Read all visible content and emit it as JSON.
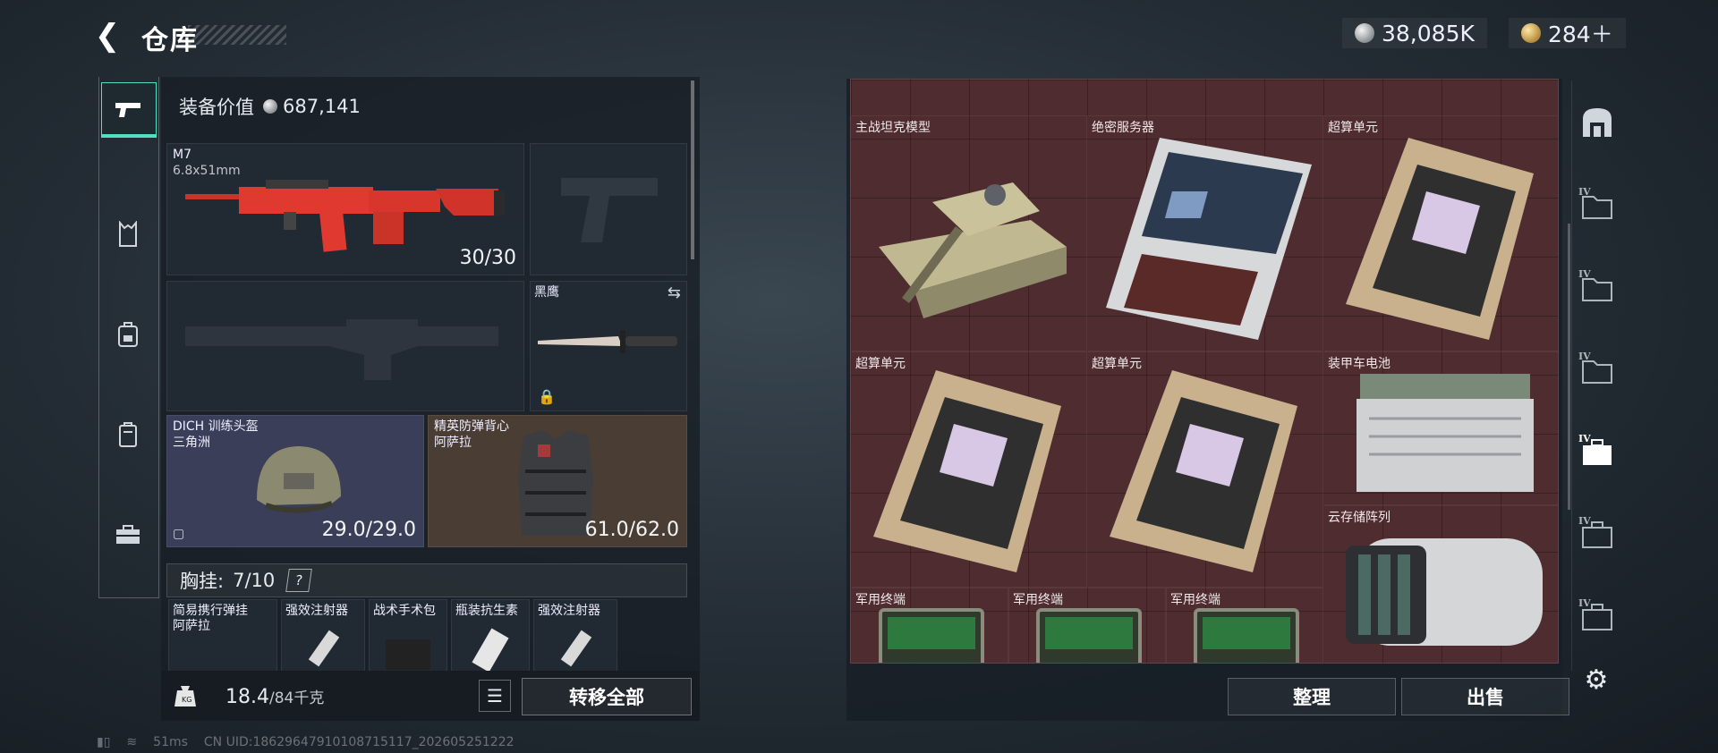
{
  "header": {
    "back_icon": "chevron-left-icon",
    "title": "仓库"
  },
  "currency": {
    "silver": "38,085K",
    "gold": "284＋"
  },
  "left_nav": [
    {
      "icon": "pistol-icon",
      "active": true
    },
    {
      "icon": "vest-icon",
      "active": false
    },
    {
      "icon": "backpack-icon",
      "active": false
    },
    {
      "icon": "pouch-icon",
      "active": false
    },
    {
      "icon": "toolbox-icon",
      "active": false
    }
  ],
  "loadout": {
    "equip_value_label": "装备价值",
    "equip_value": "687,141",
    "primary": {
      "name": "M7",
      "ammo": "6.8x51mm",
      "count": "30/30"
    },
    "knife": {
      "name": "黑鹰"
    },
    "helmet": {
      "name": "DICH 训练头盔",
      "origin": "三角洲",
      "durability": "29.0/29.0"
    },
    "armor": {
      "name": "精英防弹背心",
      "origin": "阿萨拉",
      "durability": "61.0/62.0"
    },
    "chest_label": "胸挂:",
    "chest_count": "7/10",
    "chest_help": "?",
    "chest_items": [
      {
        "name": "简易携行弹挂",
        "sub": "阿萨拉"
      },
      {
        "name": "强效注射器",
        "sub": ""
      },
      {
        "name": "战术手术包",
        "sub": ""
      },
      {
        "name": "瓶装抗生素",
        "sub": ""
      },
      {
        "name": "强效注射器",
        "sub": ""
      }
    ],
    "weight": "18.4",
    "weight_max": "/84千克",
    "transfer_all": "转移全部"
  },
  "stash": {
    "items": [
      {
        "name": "主战坦克模型"
      },
      {
        "name": "绝密服务器"
      },
      {
        "name": "超算单元"
      },
      {
        "name": "超算单元"
      },
      {
        "name": "超算单元"
      },
      {
        "name": "装甲车电池"
      },
      {
        "name": "云存储阵列"
      },
      {
        "name": "军用终端"
      },
      {
        "name": "军用终端"
      },
      {
        "name": "军用终端"
      }
    ],
    "sort_label": "整理",
    "sell_label": "出售"
  },
  "right_nav": {
    "tab_label": "IV",
    "tabs": [
      "stash-icon",
      "folder-icon",
      "folder-icon",
      "folder-icon",
      "case-icon",
      "case-icon",
      "case-icon"
    ]
  },
  "status_bar": {
    "ping": "51ms",
    "uid": "CN UID:18629647910108715117_202605251222"
  },
  "colors": {
    "accent": "#51e0c4",
    "grid_bg": "#4e2c30",
    "weapon_red": "#e0392f"
  }
}
